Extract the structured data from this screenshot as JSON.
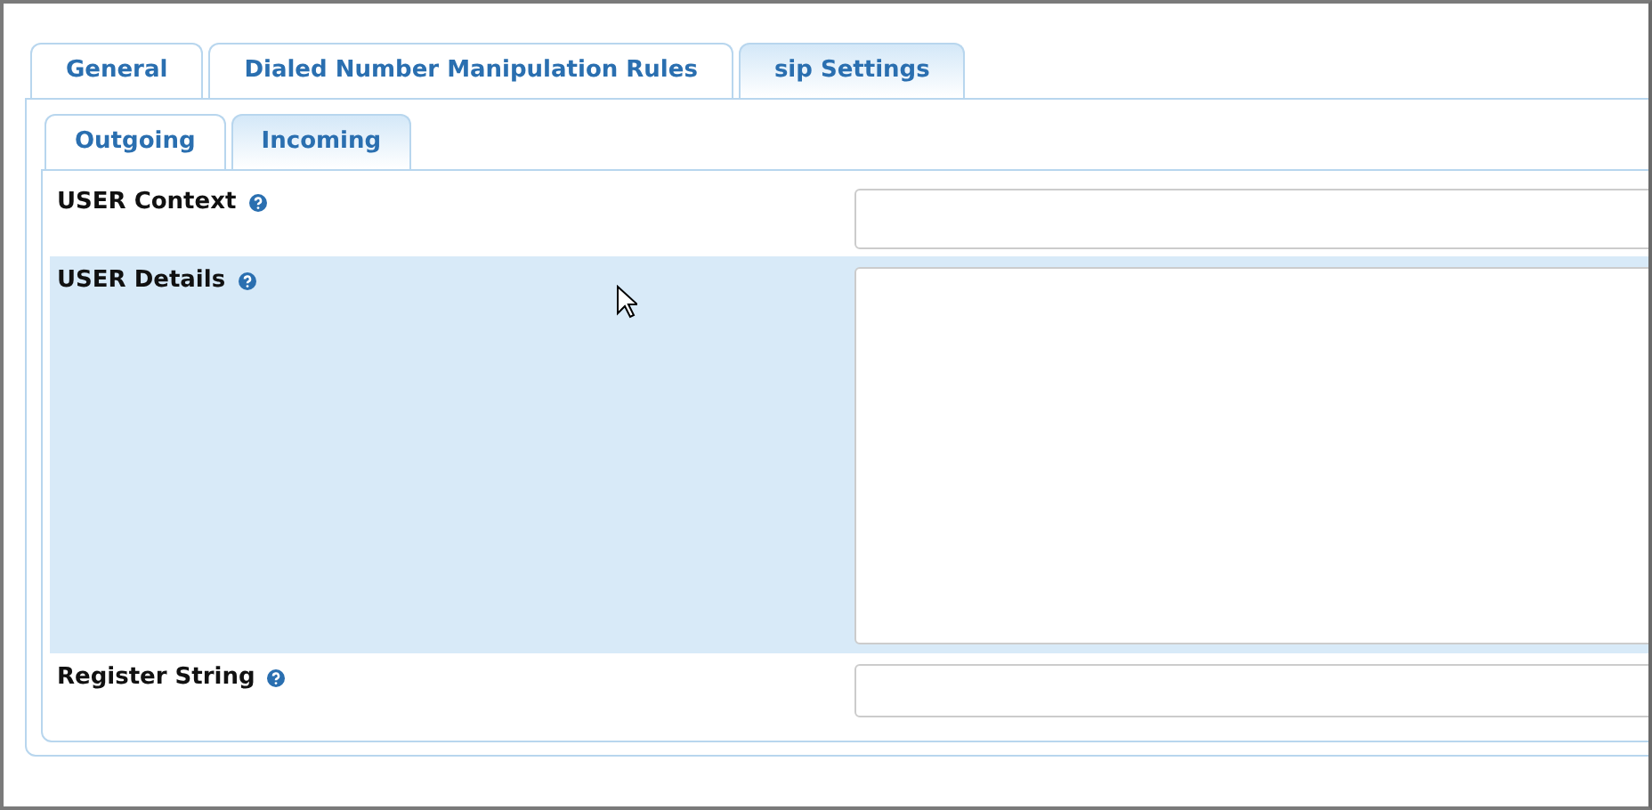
{
  "tabs": [
    {
      "label": "General",
      "selected": false
    },
    {
      "label": "Dialed Number Manipulation Rules",
      "selected": false
    },
    {
      "label": "sip Settings",
      "selected": true
    }
  ],
  "subtabs": [
    {
      "label": "Outgoing",
      "selected": false
    },
    {
      "label": "Incoming",
      "selected": true
    }
  ],
  "rows": [
    {
      "label": "USER Context",
      "kind": "input",
      "highlighted": false
    },
    {
      "label": "USER Details",
      "kind": "textarea",
      "highlighted": true
    },
    {
      "label": "Register String",
      "kind": "input",
      "highlighted": false
    }
  ]
}
